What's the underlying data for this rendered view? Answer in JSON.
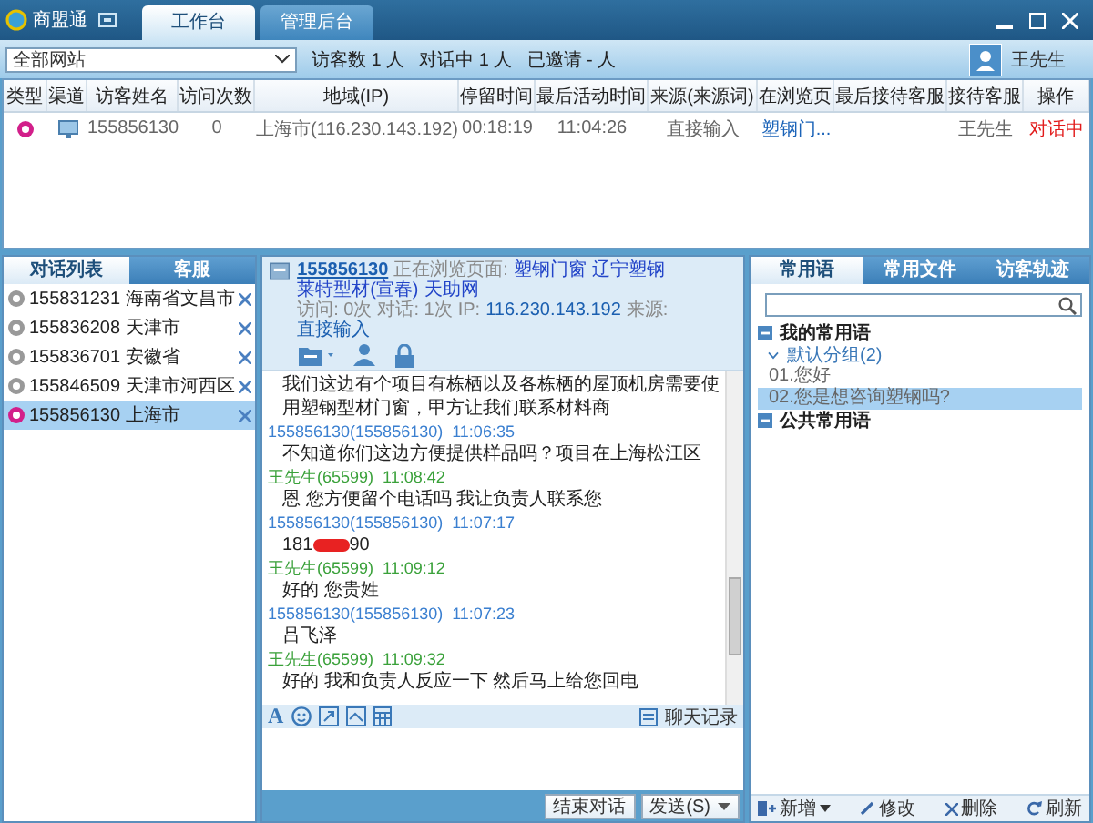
{
  "app": {
    "name": "商盟通"
  },
  "main_tabs": [
    {
      "label": "工作台",
      "selected": true
    },
    {
      "label": "管理后台",
      "selected": false
    }
  ],
  "site_select": {
    "value": "全部网站"
  },
  "stats": [
    "访客数 1 人",
    "对话中 1 人",
    "已邀请 - 人"
  ],
  "user": {
    "name": "王先生"
  },
  "visitor_table": {
    "columns": [
      "类型",
      "渠道",
      "访客姓名",
      "访问次数",
      "地域(IP)",
      "停留时间",
      "最后活动时间",
      "来源(来源词)",
      "在浏览页",
      "最后接待客服",
      "接待客服",
      "操作"
    ],
    "rows": [
      {
        "name": "155856130",
        "visits": "0",
        "region": "上海市(116.230.143.192)",
        "stay": "00:18:19",
        "last_active": "11:04:26",
        "source": "直接输入",
        "page": "塑钢门...",
        "agent": "王先生",
        "action": "对话中"
      }
    ]
  },
  "left_tabs": [
    {
      "label": "对话列表",
      "selected": true
    },
    {
      "label": "客服",
      "selected": false
    }
  ],
  "conversations": [
    {
      "id": "155831231",
      "region": "海南省文昌市",
      "selected": false
    },
    {
      "id": "155836208",
      "region": "天津市",
      "selected": false
    },
    {
      "id": "155836701",
      "region": "安徽省",
      "selected": false
    },
    {
      "id": "155846509",
      "region": "天津市河西区",
      "selected": false
    },
    {
      "id": "155856130",
      "region": "上海市",
      "selected": true
    }
  ],
  "chat": {
    "visitor": "155856130",
    "browsing_label": "正在浏览页面:",
    "pages": [
      "塑钢门窗",
      "辽宁塑钢",
      "莱特型材(宣春)",
      "天助网"
    ],
    "info": [
      {
        "text": "访问: 0次",
        "highlight": false
      },
      {
        "text": "对话: 1次",
        "highlight": false
      },
      {
        "text": "IP:",
        "highlight": false
      },
      {
        "text": "116.230.143.192",
        "highlight": true
      },
      {
        "text": "来源:",
        "highlight": false
      },
      {
        "text": "直接输入",
        "highlight": true
      }
    ],
    "messages": [
      {
        "kind": "text",
        "text": "我们这边有个项目有栋栖以及各栋栖的屋顶机房需要使用塑钢型材门窗，甲方让我们联系材料商"
      },
      {
        "kind": "text",
        "agent": false,
        "name": "155856130(155856130)",
        "time": "11:06:35",
        "text": "不知道你们这边方便提供样品吗？项目在上海松江区"
      },
      {
        "kind": "text",
        "agent": true,
        "name": "王先生(65599)",
        "time": "11:08:42",
        "text": "恩  您方便留个电话吗  我让负责人联系您"
      },
      {
        "kind": "redacted",
        "agent": false,
        "name": "155856130(155856130)",
        "time": "11:07:17",
        "text_start": "181",
        "text_end": "90"
      },
      {
        "kind": "text",
        "agent": true,
        "name": "王先生(65599)",
        "time": "11:09:12",
        "text": "好的  您贵姓"
      },
      {
        "kind": "text",
        "agent": false,
        "name": "155856130(155856130)",
        "time": "11:07:23",
        "text": "吕飞泽"
      },
      {
        "kind": "text",
        "agent": true,
        "name": "王先生(65599)",
        "time": "11:09:32",
        "text": "好的    我和负责人反应一下  然后马上给您回电"
      }
    ],
    "font_button": "A",
    "history_button": "聊天记录",
    "end_button": "结束对话",
    "send_button": "发送(S)"
  },
  "right_tabs": [
    {
      "label": "常用语",
      "selected": true
    },
    {
      "label": "常用文件",
      "selected": false
    },
    {
      "label": "访客轨迹",
      "selected": false
    }
  ],
  "phrase_tree": [
    {
      "label": "我的常用语",
      "expanded": true,
      "children": [
        {
          "label": "默认分组(2)",
          "expanded": true,
          "children": [
            {
              "label": "01.您好",
              "selected": false
            },
            {
              "label": "02.您是想咨询塑钢吗?",
              "selected": true
            }
          ]
        }
      ]
    },
    {
      "label": "公共常用语",
      "expanded": true
    }
  ],
  "phrase_actions": [
    {
      "kind": "add",
      "label": "新增"
    },
    {
      "kind": "edit",
      "label": "修改"
    },
    {
      "kind": "delete",
      "label": "删除"
    },
    {
      "kind": "refresh",
      "label": "刷新"
    }
  ]
}
